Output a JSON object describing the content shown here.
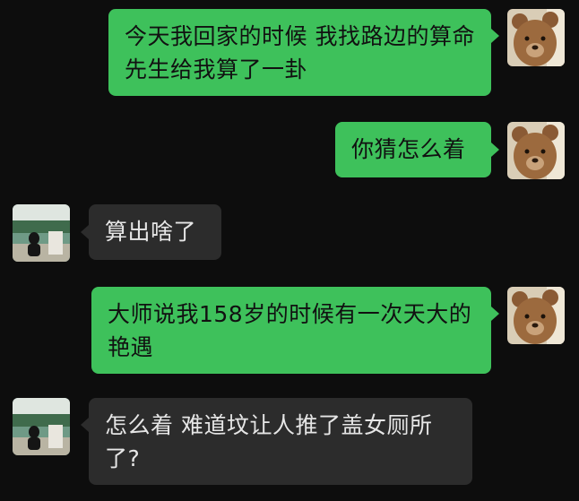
{
  "messages": [
    {
      "side": "out",
      "text": "今天我回家的时候 我找路边的算命先生给我算了一卦"
    },
    {
      "side": "out",
      "text": "你猜怎么着"
    },
    {
      "side": "in",
      "text": "算出啥了"
    },
    {
      "side": "out",
      "text": "大师说我158岁的时候有一次天大的艳遇"
    },
    {
      "side": "in",
      "text": "怎么着 难道坟让人推了盖女厕所了?"
    }
  ],
  "colors": {
    "outgoing_bubble": "#3ec15b",
    "incoming_bubble": "#2c2c2c",
    "background": "#0d0d0d"
  },
  "avatars": {
    "self": "teddy-bear-photo",
    "friend": "person-by-lake-photo"
  }
}
